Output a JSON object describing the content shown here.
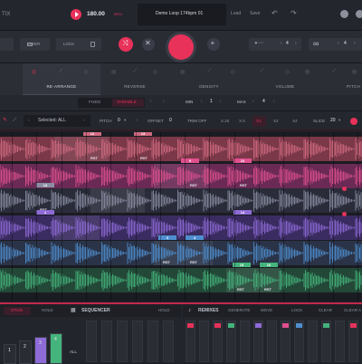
{
  "header": {
    "app_name_partial": "TIX",
    "bpm": "180.00",
    "bpm_unit": "BPM",
    "preset_name": "Demo Loop 174bpm 01",
    "load_label": "Load",
    "save_label": "Save",
    "record_color": "#e8325a"
  },
  "controls": {
    "mixer_label": "MIXER",
    "lock_label": "LOCK",
    "value_left": "4",
    "value_right": "4"
  },
  "tabs": [
    {
      "label": "RE-ARRANGE"
    },
    {
      "label": "REVERSE"
    },
    {
      "label": "DENSITY"
    },
    {
      "label": "VOLUME"
    },
    {
      "label": "PITCH"
    }
  ],
  "subrow": {
    "fixed_label": "FIXED",
    "variable_label": "VARIABLE",
    "min_label": "MIN",
    "min_value": "1",
    "max_label": "MAX",
    "max_value": "4"
  },
  "toolbar": {
    "selected_label": "Selected: ALL",
    "pitch_label": "PITCH",
    "pitch_value": "0",
    "offset_label": "OFFSET",
    "offset_value": "0",
    "trim_label": "TRIM OFF",
    "speeds": [
      "X.25",
      "X.5",
      "X1",
      "X2",
      "X4"
    ],
    "active_speed": "X1",
    "slice_label": "SLICE",
    "slice_value": "20"
  },
  "lanes": [
    {
      "color": "#7a3848",
      "wave": "#d06a80",
      "flags": [
        {
          "n": "12"
        },
        {
          "n": "13"
        }
      ],
      "rst": [
        "RST",
        "RST"
      ]
    },
    {
      "color": "#6a2a55",
      "wave": "#e0508f",
      "flags": [
        {
          "n": "9"
        },
        {
          "n": "10"
        }
      ],
      "rst": [
        "RST",
        "RST"
      ]
    },
    {
      "color": "#2a2c3a",
      "wave": "#8a8ea2",
      "flags": [
        {
          "n": "13"
        }
      ],
      "rst": [
        "RST"
      ]
    },
    {
      "color": "#3a2c60",
      "wave": "#8f6bd8",
      "flags": [
        {
          "n": "1"
        },
        {
          "n": "14"
        }
      ],
      "rst": [
        "RST"
      ]
    },
    {
      "color": "#2a3348",
      "wave": "#4f8fd0",
      "flags": [
        {
          "n": "3"
        },
        {
          "n": "4"
        }
      ],
      "rst": [
        "RST",
        "RST"
      ]
    },
    {
      "color": "#234838",
      "wave": "#45b37c",
      "flags": [
        {
          "n": "15"
        },
        {
          "n": "16"
        }
      ],
      "rst": [
        "RST",
        "RST"
      ]
    }
  ],
  "bottom": {
    "left_tabs": [
      "OTON",
      "HOLD"
    ],
    "sequencer_label": "SEQUENCER",
    "hold_label": "HOLD",
    "remixes_label": "REMIXES",
    "remix_buttons": [
      "GENERATE",
      "MOVE",
      "LOCK",
      "CLEAR",
      "CLEAR A"
    ],
    "all_label": "ALL",
    "pad_numbers": [
      "1",
      "2",
      "3",
      "4"
    ],
    "pad_colors": [
      "#2a2c34",
      "#2a2c34",
      "#8f6bd8",
      "#45b37c"
    ]
  },
  "colors": {
    "accent": "#e8325a",
    "pink": "#e0508f",
    "purple": "#8f6bd8",
    "blue": "#4f8fd0",
    "green": "#45b37c"
  }
}
